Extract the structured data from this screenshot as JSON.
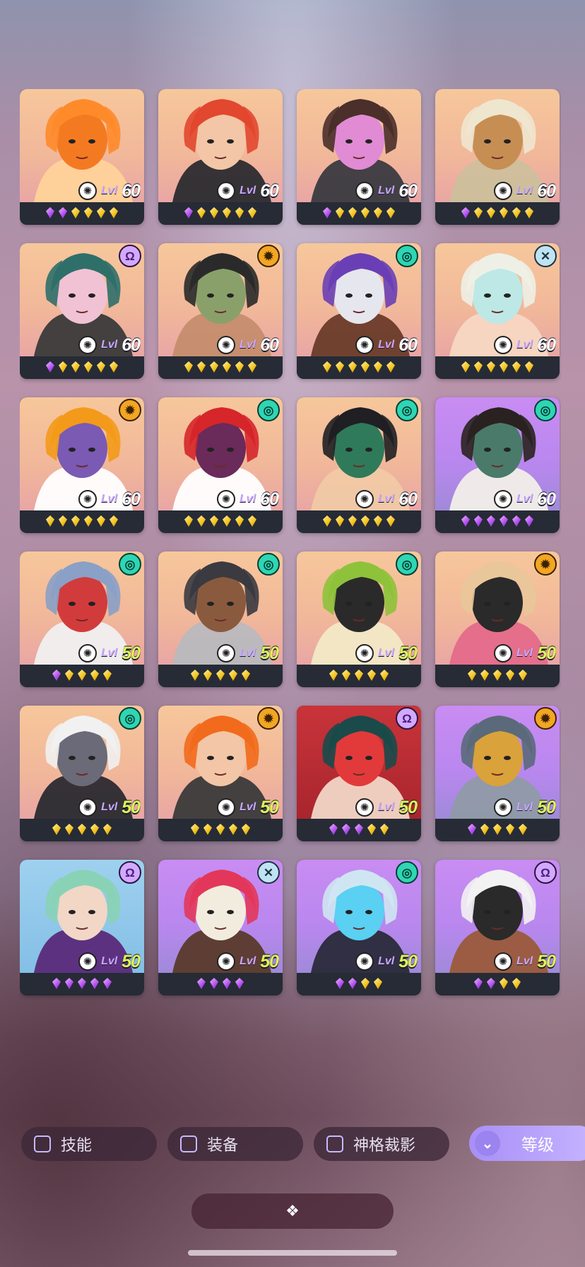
{
  "heroes": [
    {
      "level_label": "Lvl",
      "level": "60",
      "faction": "",
      "bg": "orange",
      "palette": [
        "#ff8a2a",
        "#ffd29a",
        "#f47a22"
      ],
      "gems": [
        "p",
        "p",
        "g",
        "g",
        "g",
        "g"
      ]
    },
    {
      "level_label": "Lvl",
      "level": "60",
      "faction": "",
      "bg": "orange",
      "palette": [
        "#e2472f",
        "#2b2b2f",
        "#f2c6a6"
      ],
      "gems": [
        "p",
        "g",
        "g",
        "g",
        "g",
        "g"
      ]
    },
    {
      "level_label": "Lvl",
      "level": "60",
      "faction": "",
      "bg": "orange",
      "palette": [
        "#4a2f2a",
        "#3a3a40",
        "#e08bd4"
      ],
      "gems": [
        "p",
        "g",
        "g",
        "g",
        "g",
        "g"
      ]
    },
    {
      "level_label": "Lvl",
      "level": "60",
      "faction": "",
      "bg": "orange",
      "palette": [
        "#efe6cf",
        "#cdbf9c",
        "#c68e53"
      ],
      "gems": [
        "p",
        "g",
        "g",
        "g",
        "g",
        "g"
      ]
    },
    {
      "level_label": "Lvl",
      "level": "60",
      "faction": "void",
      "bg": "orange",
      "palette": [
        "#2f6f6a",
        "#3a3a3a",
        "#f1c2d4"
      ],
      "gems": [
        "p",
        "g",
        "g",
        "g",
        "g",
        "g"
      ]
    },
    {
      "level_label": "Lvl",
      "level": "60",
      "faction": "sun",
      "bg": "orange",
      "palette": [
        "#2a2a2a",
        "#c58d6e",
        "#8aa06a"
      ],
      "gems": [
        "g",
        "g",
        "g",
        "g",
        "g",
        "g"
      ]
    },
    {
      "level_label": "Lvl",
      "level": "60",
      "faction": "spiral",
      "bg": "orange",
      "palette": [
        "#6a3fb5",
        "#6a3b2a",
        "#e6e6ee"
      ],
      "gems": [
        "g",
        "g",
        "g",
        "g",
        "g",
        "g"
      ]
    },
    {
      "level_label": "Lvl",
      "level": "60",
      "faction": "cross",
      "bg": "orange",
      "palette": [
        "#eef0e6",
        "#f7d7c3",
        "#bde8e6"
      ],
      "gems": [
        "g",
        "g",
        "g",
        "g",
        "g",
        "g"
      ]
    },
    {
      "level_label": "Lvl",
      "level": "60",
      "faction": "sun",
      "bg": "orange",
      "palette": [
        "#f39a1a",
        "#ffffff",
        "#7a5ab3"
      ],
      "gems": [
        "g",
        "g",
        "g",
        "g",
        "g",
        "g"
      ]
    },
    {
      "level_label": "Lvl",
      "level": "60",
      "faction": "spiral",
      "bg": "orange",
      "palette": [
        "#d6262a",
        "#ffffff",
        "#6a2a5a"
      ],
      "gems": [
        "g",
        "g",
        "g",
        "g",
        "g",
        "g"
      ]
    },
    {
      "level_label": "Lvl",
      "level": "60",
      "faction": "spiral",
      "bg": "orange",
      "palette": [
        "#1f1f24",
        "#f1c9a5",
        "#2f7a5a"
      ],
      "gems": [
        "g",
        "g",
        "g",
        "g",
        "g",
        "g"
      ]
    },
    {
      "level_label": "Lvl",
      "level": "60",
      "faction": "spiral",
      "bg": "purple",
      "palette": [
        "#2a2220",
        "#f2efe9",
        "#4a7a6a"
      ],
      "gems": [
        "p",
        "p",
        "p",
        "p",
        "p",
        "p"
      ]
    },
    {
      "level_label": "Lvl",
      "level": "50",
      "faction": "spiral",
      "bg": "orange",
      "palette": [
        "#8aa0c6",
        "#f0f0f0",
        "#d23b3b"
      ],
      "gems": [
        "p",
        "g",
        "g",
        "g",
        "g"
      ]
    },
    {
      "level_label": "Lvl",
      "level": "50",
      "faction": "spiral",
      "bg": "orange",
      "palette": [
        "#3a3a40",
        "#b9b9bf",
        "#8a5a3e"
      ],
      "gems": [
        "g",
        "g",
        "g",
        "g",
        "g"
      ]
    },
    {
      "level_label": "Lvl",
      "level": "50",
      "faction": "spiral",
      "bg": "orange",
      "palette": [
        "#8ec23a",
        "#f2e9c7",
        "#2a2a2a"
      ],
      "gems": [
        "g",
        "g",
        "g",
        "g",
        "g"
      ]
    },
    {
      "level_label": "Lvl",
      "level": "50",
      "faction": "sun",
      "bg": "orange",
      "palette": [
        "#eac79a",
        "#e46a8a",
        "#2a2a2a"
      ],
      "gems": [
        "g",
        "g",
        "g",
        "g",
        "g"
      ]
    },
    {
      "level_label": "Lvl",
      "level": "50",
      "faction": "spiral",
      "bg": "orange",
      "palette": [
        "#f1f1f1",
        "#2a2a30",
        "#6a6a78"
      ],
      "gems": [
        "g",
        "g",
        "g",
        "g",
        "g"
      ]
    },
    {
      "level_label": "Lvl",
      "level": "50",
      "faction": "sun",
      "bg": "orange",
      "palette": [
        "#f26a1c",
        "#3a3a3a",
        "#f2c6a6"
      ],
      "gems": [
        "g",
        "g",
        "g",
        "g",
        "g"
      ]
    },
    {
      "level_label": "Lvl",
      "level": "50",
      "faction": "void",
      "bg": "red",
      "palette": [
        "#1a4a4a",
        "#f2d6c6",
        "#e23a3a"
      ],
      "gems": [
        "p",
        "p",
        "p",
        "g",
        "g"
      ]
    },
    {
      "level_label": "Lvl",
      "level": "50",
      "faction": "sun",
      "bg": "purple",
      "palette": [
        "#5a6a7a",
        "#8f9aa6",
        "#d9a23a"
      ],
      "gems": [
        "p",
        "g",
        "g",
        "g",
        "g"
      ]
    },
    {
      "level_label": "Lvl",
      "level": "50",
      "faction": "void",
      "bg": "blue",
      "palette": [
        "#8ad2b6",
        "#5a2a7a",
        "#f2d6c6"
      ],
      "gems": [
        "p",
        "p",
        "p",
        "p",
        "p"
      ]
    },
    {
      "level_label": "Lvl",
      "level": "50",
      "faction": "cross",
      "bg": "purple",
      "palette": [
        "#e2375a",
        "#5a3a2a",
        "#f2ecde"
      ],
      "gems": [
        "p",
        "p",
        "p",
        "p"
      ]
    },
    {
      "level_label": "Lvl",
      "level": "50",
      "faction": "spiral",
      "bg": "purple",
      "palette": [
        "#cfe6f2",
        "#2a2a3a",
        "#5ad0f2"
      ],
      "gems": [
        "p",
        "p",
        "g",
        "g"
      ]
    },
    {
      "level_label": "Lvl",
      "level": "50",
      "faction": "void",
      "bg": "purple",
      "palette": [
        "#f2f2f2",
        "#9a5a3a",
        "#2a2a2a"
      ],
      "gems": [
        "p",
        "p",
        "g",
        "g"
      ]
    }
  ],
  "filters": [
    {
      "label": "技能",
      "checked": false
    },
    {
      "label": "装备",
      "checked": false
    },
    {
      "label": "神格裁影",
      "checked": false
    }
  ],
  "sort": {
    "label": "等级",
    "icon": "double-chevron-down-icon"
  },
  "collapse": {
    "icon": "diamond-cluster-icon",
    "glyph": "❖"
  },
  "faction_icons": {
    "void": "Ω",
    "sun": "✹",
    "spiral": "◎",
    "cross": "✕"
  }
}
